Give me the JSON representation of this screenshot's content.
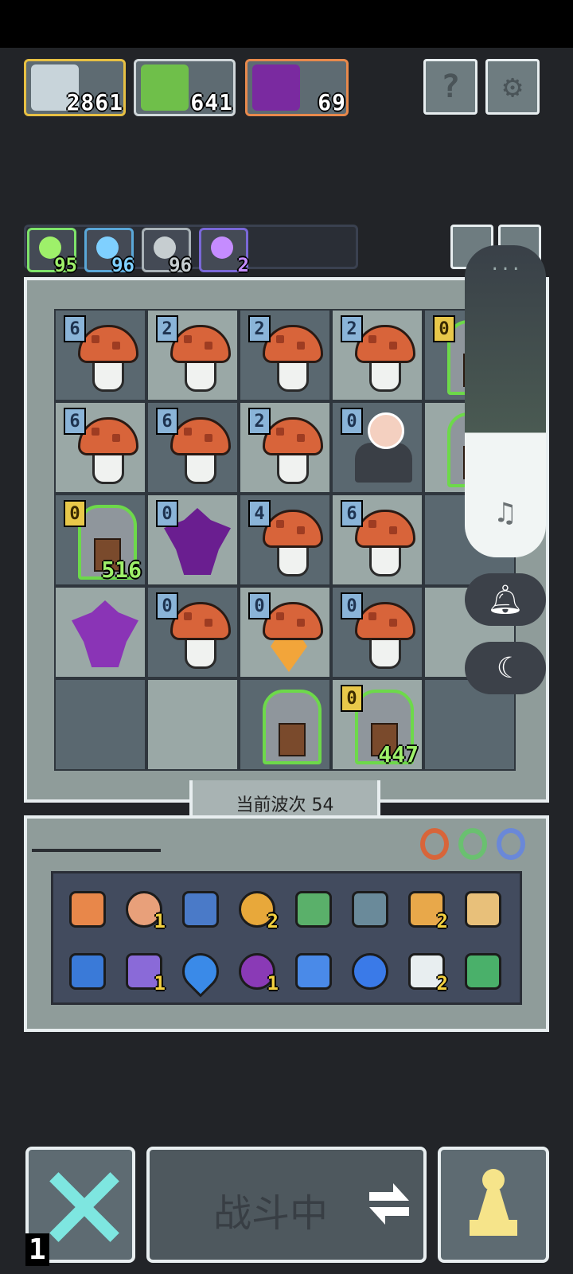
{
  "resources": [
    {
      "name": "hero-portrait",
      "value": "2861",
      "border": "#e7c043"
    },
    {
      "name": "green-slime",
      "value": "641",
      "border": "#d0d7da"
    },
    {
      "name": "purple-demon",
      "value": "69",
      "border": "#e8894c"
    }
  ],
  "top_buttons": {
    "help": "?",
    "settings": "⚙"
  },
  "stats": [
    {
      "icon": "green-orb-icon",
      "value": "95",
      "color": "#9ef06a",
      "border": "#7ee36a"
    },
    {
      "icon": "spiral-icon",
      "value": "96",
      "color": "#7fd0ff",
      "border": "#5aa7d8"
    },
    {
      "icon": "crossed-swords-icon",
      "value": "96",
      "color": "#c6cdd0",
      "border": "#aab3b8"
    },
    {
      "icon": "lightning-icon",
      "value": "2",
      "color": "#c58cff",
      "border": "#7a68d8"
    }
  ],
  "board": {
    "rows": [
      [
        {
          "type": "mushroom",
          "count": "6",
          "bg": "d"
        },
        {
          "type": "mushroom",
          "count": "2",
          "bg": "l"
        },
        {
          "type": "mushroom",
          "count": "2",
          "bg": "d"
        },
        {
          "type": "mushroom",
          "count": "2",
          "bg": "l"
        },
        {
          "type": "tomb",
          "count": "0",
          "countColor": "y",
          "bg": "d"
        }
      ],
      [
        {
          "type": "mushroom",
          "count": "6",
          "bg": "l"
        },
        {
          "type": "mushroom",
          "count": "6",
          "bg": "d"
        },
        {
          "type": "mushroom",
          "count": "2",
          "bg": "l"
        },
        {
          "type": "hero",
          "count": "0",
          "bg": "d"
        },
        {
          "type": "tomb",
          "count": "",
          "bg": "l"
        }
      ],
      [
        {
          "type": "tomb",
          "count": "0",
          "countColor": "y",
          "hp": "516",
          "bg": "d"
        },
        {
          "type": "demon",
          "count": "0",
          "bg": "l"
        },
        {
          "type": "mushroom",
          "count": "4",
          "bg": "d"
        },
        {
          "type": "mushroom",
          "count": "6",
          "bg": "l"
        },
        {
          "type": "empty",
          "count": "",
          "bg": "d"
        }
      ],
      [
        {
          "type": "demon2",
          "count": "",
          "bg": "l"
        },
        {
          "type": "mushroom",
          "count": "0",
          "bg": "d"
        },
        {
          "type": "mushroom-gem",
          "count": "0",
          "bg": "l"
        },
        {
          "type": "mushroom",
          "count": "0",
          "bg": "d"
        },
        {
          "type": "empty",
          "count": "",
          "bg": "l"
        }
      ],
      [
        {
          "type": "empty",
          "count": "",
          "bg": "d"
        },
        {
          "type": "empty",
          "count": "",
          "bg": "l"
        },
        {
          "type": "tomb",
          "count": "",
          "bg": "d"
        },
        {
          "type": "tomb",
          "count": "0",
          "countColor": "y",
          "hp": "447",
          "bg": "l"
        },
        {
          "type": "empty",
          "count": "",
          "bg": "d"
        }
      ]
    ]
  },
  "wave_label": "当前波次 54",
  "rings": [
    "#d8653a",
    "#6ac070",
    "#6a88d8"
  ],
  "inventory": [
    {
      "name": "scroll-icon",
      "color": "#e8874a",
      "qty": "",
      "shape": "sq"
    },
    {
      "name": "eye-orb-icon",
      "color": "#e8a07a",
      "qty": "1",
      "shape": "round"
    },
    {
      "name": "goggles-icon",
      "color": "#4a7ac8",
      "qty": "",
      "shape": "sq"
    },
    {
      "name": "golden-ring-icon",
      "color": "#e8a83a",
      "qty": "2",
      "shape": "round"
    },
    {
      "name": "arrow-icon",
      "color": "#5ab06a",
      "qty": "",
      "shape": "sq"
    },
    {
      "name": "shuriken-icon",
      "color": "#6a8a9a",
      "qty": "",
      "shape": "sq"
    },
    {
      "name": "spark-claw-icon",
      "color": "#e8a84a",
      "qty": "2",
      "shape": "sq"
    },
    {
      "name": "bone-claw-icon",
      "color": "#e8c07a",
      "qty": "",
      "shape": "sq"
    },
    {
      "name": "blue-flame-icon",
      "color": "#3a7ad8",
      "qty": "",
      "shape": "sq"
    },
    {
      "name": "potion-jar-icon",
      "color": "#8a6ad8",
      "qty": "1",
      "shape": "sq"
    },
    {
      "name": "water-drop-icon",
      "color": "#3a8ae8",
      "qty": "",
      "shape": "drop"
    },
    {
      "name": "demon-medal-icon",
      "color": "#8a3ab6",
      "qty": "1",
      "shape": "round"
    },
    {
      "name": "blue-wing-icon",
      "color": "#4a8ae8",
      "qty": "",
      "shape": "sq"
    },
    {
      "name": "whale-icon",
      "color": "#3a7ae8",
      "qty": "",
      "shape": "round"
    },
    {
      "name": "white-wings-icon",
      "color": "#e8eef0",
      "qty": "2",
      "shape": "sq"
    },
    {
      "name": "green-feather-icon",
      "color": "#4ab06a",
      "qty": "",
      "shape": "sq"
    }
  ],
  "bottom": {
    "cancel_badge": "1",
    "battle_label": "战斗中"
  },
  "accent": "#e8eef0"
}
